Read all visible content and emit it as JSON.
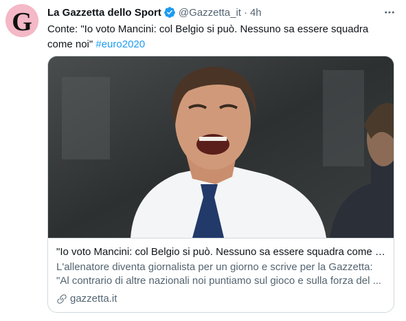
{
  "author": {
    "display_name": "La Gazzetta dello Sport",
    "handle": "@Gazzetta_it",
    "separator": "·",
    "time": "4h",
    "avatar_letter": "G",
    "verified_icon": "verified-badge-icon"
  },
  "tweet": {
    "text": "Conte: \"Io voto Mancini: col Belgio si può. Nessuno sa essere squadra come noi\"",
    "hashtag": "#euro2020"
  },
  "card": {
    "image_alt": "Antonio Conte shouting",
    "title": "\"Io voto Mancini: col Belgio si può. Nessuno sa essere squadra come n...",
    "description": "L'allenatore diventa giornalista per un giorno e scrive per la Gazzetta: \"Al contrario di altre nazionali noi puntiamo sul gioco e sulla forza del ...",
    "domain": "gazzetta.it",
    "domain_icon": "link-icon"
  },
  "colors": {
    "accent": "#1d9bf0",
    "secondary_text": "#536471",
    "avatar_bg": "#f4b8c6",
    "border": "#cfd9de"
  }
}
